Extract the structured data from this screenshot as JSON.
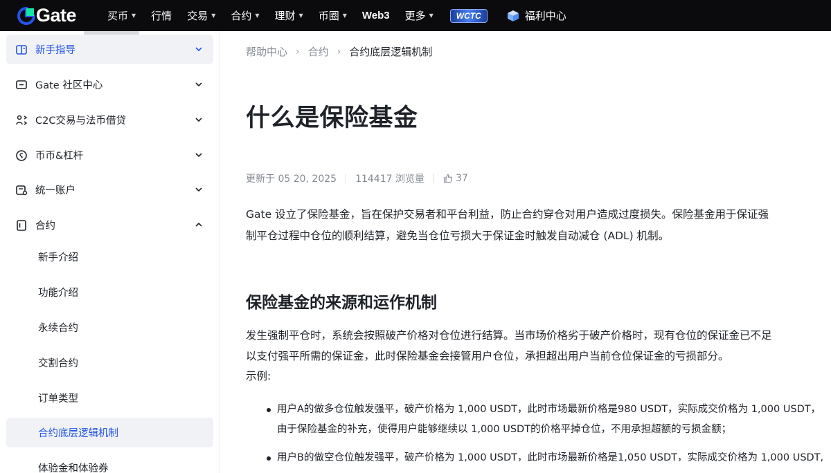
{
  "brand": {
    "name": "Gate"
  },
  "nav": {
    "items": [
      {
        "label": "买币",
        "caret": true
      },
      {
        "label": "行情",
        "caret": false
      },
      {
        "label": "交易",
        "caret": true
      },
      {
        "label": "合约",
        "caret": true
      },
      {
        "label": "理财",
        "caret": true
      },
      {
        "label": "币圈",
        "caret": true
      },
      {
        "label": "Web3",
        "caret": false
      },
      {
        "label": "更多",
        "caret": true
      }
    ],
    "wctc_badge": "WCTC",
    "rewards_label": "福利中心"
  },
  "sidebar": {
    "sections": [
      {
        "label": "新手指导",
        "icon": "book-icon",
        "expanded": false,
        "highlighted": true
      },
      {
        "label": "Gate 社区中心",
        "icon": "chat-icon",
        "expanded": false
      },
      {
        "label": "C2C交易与法币借贷",
        "icon": "users-swap-icon",
        "expanded": false
      },
      {
        "label": "币币&杠杆",
        "icon": "coin-icon",
        "expanded": false
      },
      {
        "label": "统一账户",
        "icon": "account-icon",
        "expanded": false
      },
      {
        "label": "合约",
        "icon": "document-icon",
        "expanded": true
      }
    ],
    "sub_items": [
      {
        "label": "新手介绍"
      },
      {
        "label": "功能介绍"
      },
      {
        "label": "永续合约"
      },
      {
        "label": "交割合约"
      },
      {
        "label": "订单类型"
      },
      {
        "label": "合约底层逻辑机制",
        "current": true
      },
      {
        "label": "体验金和体验券"
      }
    ]
  },
  "breadcrumb": [
    "帮助中心",
    "合约",
    "合约底层逻辑机制"
  ],
  "article": {
    "title": "什么是保险基金",
    "meta": {
      "updated": "更新于 05 20, 2025",
      "views": "114417 浏览量",
      "likes": "37"
    },
    "intro_lines": [
      "Gate 设立了保险基金，旨在保护交易者和平台利益，防止合约穿仓对用户造成过度损失。保险基金用于保证强",
      "制平仓过程中仓位的顺利结算，避免当仓位亏损大于保证金时触发自动减仓 (ADL) 机制。"
    ],
    "section_heading": "保险基金的来源和运作机制",
    "body_lines": [
      "发生强制平仓时，系统会按照破产价格对仓位进行结算。当市场价格劣于破产价格时，现有仓位的保证金已不足",
      "以支付强平所需的保证金，此时保险基金会接管用户仓位，承担超出用户当前仓位保证金的亏损部分。",
      "示例:"
    ],
    "bullets": [
      {
        "line1": "用户A的做多仓位触发强平，破产价格为 1,000 USDT，此时市场最新价格是980 USDT，实际成交价格为 1,000 USDT，",
        "line2": "由于保险基金的补充，使得用户能够继续以 1,000 USDT的价格平掉仓位，不用承担超额的亏损金额；"
      },
      {
        "line1": "用户B的做空仓位触发强平，破产价格为 1,000 USDT，此时市场最新价格是1,050 USDT，实际成交价格为 1,000 USDT,",
        "line2": ""
      }
    ]
  },
  "colors": {
    "accent": "#2354e6",
    "topbar": "#0b0b0d",
    "active_bg": "#f0f2f6"
  }
}
